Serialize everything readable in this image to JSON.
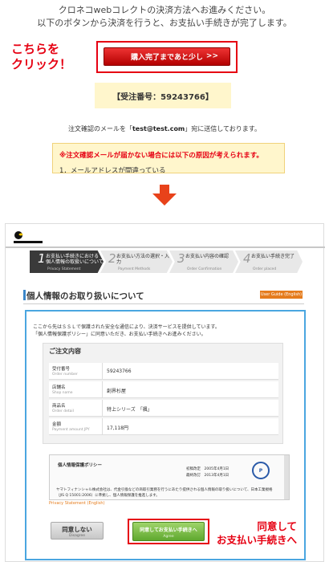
{
  "top": {
    "instruction_line1": "クロネコwebコレクトの決済方法へお進みください。",
    "instruction_line2": "以下のボタンから決済を行うと、お支払い手続きが完了します。",
    "callout": [
      "こちらを",
      "クリック！"
    ],
    "purchase_button_label": "購入完了まであと少し",
    "purchase_button_chevron": ">>",
    "order_number": "【受注番号：59243766】",
    "mail_sent_prefix": "注文確認のメールを「",
    "mail_sent_email": "test@test.com",
    "mail_sent_suffix": "」宛に送信しております。",
    "warning_title": "※注文確認メールが届かない場合には以下の原因が考えられます。",
    "warning_item": "1．メールアドレスが間違っている"
  },
  "checkout": {
    "steps": [
      {
        "num": "1",
        "label": "お支払い手続きにおける\n個人情報の取扱いについて",
        "sub": "Privacy Statement"
      },
      {
        "num": "2",
        "label": "お支払い方法の選択・入力",
        "sub": "Payment Methods"
      },
      {
        "num": "3",
        "label": "お支払い内容の確認",
        "sub": "Order Confirmation"
      },
      {
        "num": "4",
        "label": "お支払い手続き完了",
        "sub": "Order placed"
      }
    ],
    "heading": "個人情報のお取り扱いについて",
    "guide_button": "User Guide (English)",
    "intro_line1": "ここから先はＳＳＬで保護された安全な通信により、決済サービスを提供しています。",
    "intro_line2": "「個人情報保護ポリシー」に同意いただき、お支払い手続きへお進みください。",
    "order_title": "ご注文内容",
    "order_rows": [
      {
        "label": "受付番号",
        "sub": "Order number",
        "value": "59243766"
      },
      {
        "label": "店舗名",
        "sub": "Shop name",
        "value": "創界杉屋"
      },
      {
        "label": "商品名",
        "sub": "Order detail",
        "value": "特上シリーズ　「楓」"
      },
      {
        "label": "金額",
        "sub": "Payment amount JPY",
        "value": "17,118円"
      }
    ],
    "policy_title": "個人情報保護ポリシー",
    "policy_date1": "初稿改定　2005年4月1日",
    "policy_date2": "最終改訂　2013年4月1日",
    "policy_text": "ヤマトフィナンシャル株式会社は、代金引換などの商取引業務を行うにあたり提供される個人情報の取り扱いについて、日本工業規格（JIS Q 15001:2006）に準拠し、個人情報保護を推進します。",
    "privacy_mark": "P",
    "privacy_link": "Privacy Statement (English)",
    "disagree_label": "同意しない",
    "disagree_sub": "Disagree",
    "agree_label": "同意してお支払い手続きへ",
    "agree_sub": "Agree",
    "callout": [
      "同意して",
      "お支払い手続きへ"
    ]
  },
  "colors": {
    "accent_red": "#e60012",
    "brand_blue": "#4aa6e0",
    "agree_green": "#5fa82f",
    "guide_orange": "#e57c1d"
  }
}
